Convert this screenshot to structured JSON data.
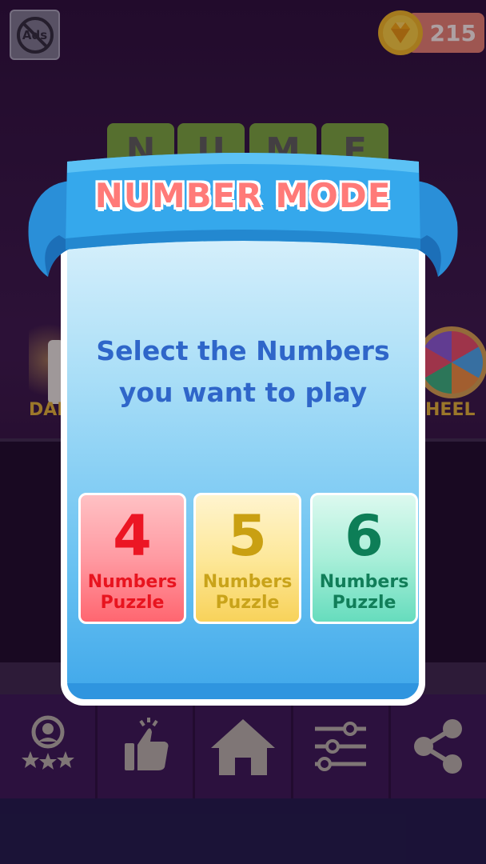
{
  "top_bar": {
    "ads_label": "Ads",
    "coin_count": "215"
  },
  "background": {
    "title_tiles": [
      "N",
      "U",
      "M",
      "E"
    ],
    "left_label": "DAIL",
    "right_label": "HEEL"
  },
  "modal": {
    "title": "NUMBER MODE",
    "prompt_line1": "Select the Numbers",
    "prompt_line2": "you want to play",
    "options": [
      {
        "number": "4",
        "label_line1": "Numbers",
        "label_line2": "Puzzle",
        "color": "#ec1624"
      },
      {
        "number": "5",
        "label_line1": "Numbers",
        "label_line2": "Puzzle",
        "color": "#c9a012"
      },
      {
        "number": "6",
        "label_line1": "Numbers",
        "label_line2": "Puzzle",
        "color": "#0d7e57"
      }
    ]
  },
  "nav": {
    "items": [
      {
        "icon": "profile-stars-icon"
      },
      {
        "icon": "thumbs-up-icon"
      },
      {
        "icon": "home-icon"
      },
      {
        "icon": "settings-sliders-icon"
      },
      {
        "icon": "share-icon"
      }
    ]
  },
  "colors": {
    "ribbon": "#2a9de0",
    "title": "#ff7a78",
    "prompt": "#2f66c9",
    "nav_bg": "#3a1850",
    "icon": "#b9b3a6"
  }
}
